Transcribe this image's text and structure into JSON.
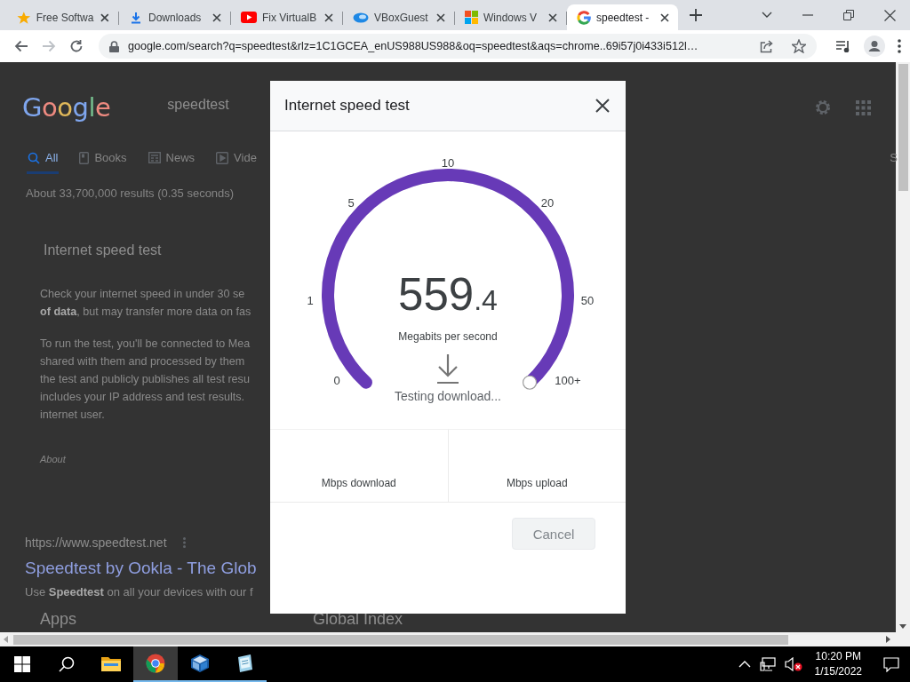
{
  "tabs": [
    {
      "title": "Free Softwa",
      "kind": "star",
      "selected": false
    },
    {
      "title": "Downloads",
      "kind": "download",
      "selected": false
    },
    {
      "title": "Fix VirtualB",
      "kind": "video",
      "selected": false
    },
    {
      "title": "VBoxGuest",
      "kind": "vbox",
      "selected": false
    },
    {
      "title": "Windows V",
      "kind": "windows",
      "selected": false
    },
    {
      "title": "speedtest -",
      "kind": "google",
      "selected": true
    }
  ],
  "address_bar": {
    "url": "google.com/search?q=speedtest&rlz=1C1GCEA_enUS988US988&oq=speedtest&aqs=chrome..69i57j0i433i512l…"
  },
  "page": {
    "logo": "Google",
    "query": "speedtest",
    "search_tabs": [
      {
        "label": "All",
        "kind": "search",
        "selected": true
      },
      {
        "label": "Books",
        "kind": "book",
        "selected": false
      },
      {
        "label": "News",
        "kind": "news",
        "selected": false
      },
      {
        "label": "Vide",
        "kind": "video",
        "selected": false
      }
    ],
    "edge_text": "S",
    "result_stats": "About 33,700,000 results (0.35 seconds)",
    "card_title": "Internet speed test",
    "card_paragraphs": [
      [
        "Check your internet speed in under 30 se",
        "**of data**, but may transfer more data on fas"
      ],
      [
        "To run the test, you'll be connected to Mea",
        "shared with them and processed by them",
        "the test and publicly publishes all test resu",
        "includes your IP address and test results.",
        "internet user."
      ]
    ],
    "card_footer": "About",
    "result": {
      "url": "https://www.speedtest.net",
      "title": "Speedtest by Ookla - The Glob",
      "snippet": "Use **Speedtest** on all your devices with our f",
      "sitelinks": [
        "Apps",
        "Global Index"
      ]
    }
  },
  "dialog": {
    "title": "Internet speed test",
    "gauge": {
      "ticks": [
        "0",
        "1",
        "5",
        "10",
        "20",
        "50",
        "100+"
      ],
      "level": 1,
      "value_whole": "559",
      "value_fraction": ".4",
      "unit": "Megabits per second",
      "status": "Testing download..."
    },
    "results": [
      "Mbps download",
      "Mbps upload"
    ],
    "cancel": {
      "label": "Cancel",
      "disabled": true
    }
  },
  "taskbar": {
    "apps": [
      {
        "kind": "explorer",
        "running": false,
        "active": false
      },
      {
        "kind": "chrome",
        "running": true,
        "active": true
      },
      {
        "kind": "vbox",
        "running": true,
        "active": false
      },
      {
        "kind": "notepad",
        "running": true,
        "active": false
      }
    ],
    "volume_muted": true,
    "time": "10:20 PM",
    "date": "1/15/2022"
  }
}
